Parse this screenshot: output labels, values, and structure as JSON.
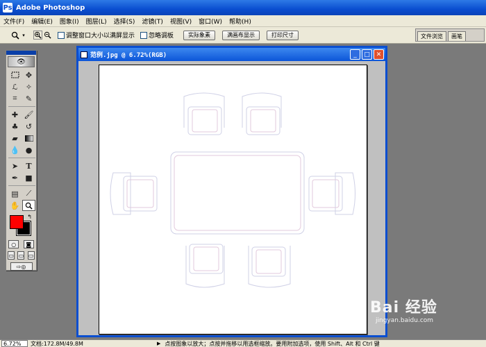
{
  "app": {
    "title": "Adobe Photoshop",
    "icon": "photoshop-icon"
  },
  "menu": [
    {
      "label": "文件(F)"
    },
    {
      "label": "编辑(E)"
    },
    {
      "label": "图象(I)"
    },
    {
      "label": "图层(L)"
    },
    {
      "label": "选择(S)"
    },
    {
      "label": "滤镜(T)"
    },
    {
      "label": "视图(V)"
    },
    {
      "label": "窗口(W)"
    },
    {
      "label": "帮助(H)"
    }
  ],
  "options": {
    "tool_icon": "zoom-icon",
    "resize_window_label": "调整窗口大小以满屏显示",
    "ignore_palettes_label": "忽略调板",
    "actual_pixels_label": "实际象素",
    "fit_on_screen_label": "满画布显示",
    "print_size_label": "打印尺寸"
  },
  "palette_well": {
    "tabs": [
      "文件浏览",
      "画笔"
    ]
  },
  "toolbox": {
    "foreground_color": "#ff0000",
    "background_color": "#000000",
    "tools": [
      "marquee-tool-icon",
      "move-tool-icon",
      "lasso-tool-icon",
      "magic-wand-tool-icon",
      "crop-tool-icon",
      "slice-tool-icon",
      "healing-brush-tool-icon",
      "brush-tool-icon",
      "clone-stamp-tool-icon",
      "history-brush-tool-icon",
      "eraser-tool-icon",
      "gradient-tool-icon",
      "blur-tool-icon",
      "dodge-tool-icon",
      "path-selection-tool-icon",
      "type-tool-icon",
      "pen-tool-icon",
      "shape-tool-icon",
      "notes-tool-icon",
      "eyedropper-tool-icon",
      "hand-tool-icon",
      "zoom-tool-icon"
    ]
  },
  "document": {
    "title": "范例.jpg @ 6.72%(RGB)"
  },
  "status": {
    "zoom": "6.72%",
    "doc_info": "文档:172.8M/49.8M",
    "hint": "点按图象以放大；点按并拖移以用选框缩放。要用附加选项，使用 Shift、Alt 和 Ctrl 键"
  },
  "watermark": {
    "main": "Bai 经验",
    "sub": "jingyan.baidu.com"
  }
}
